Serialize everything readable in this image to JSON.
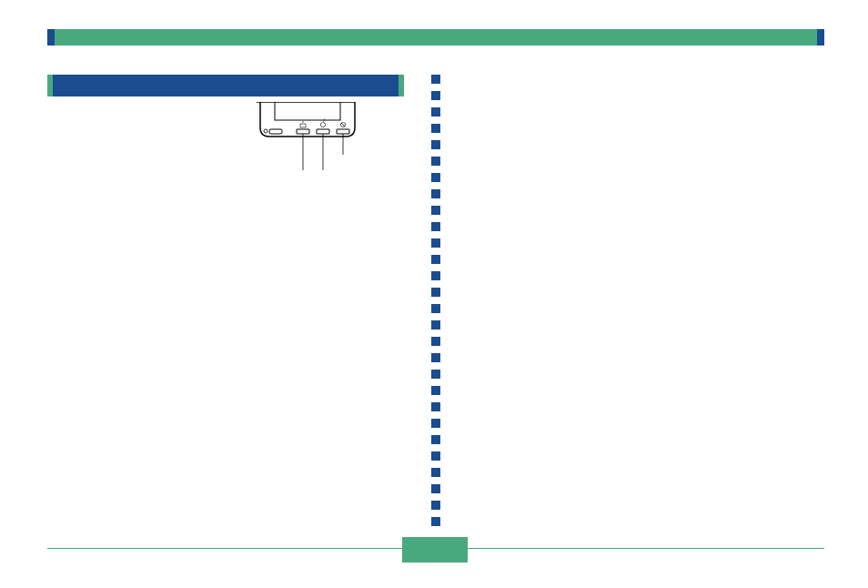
{
  "header": {
    "title": ""
  },
  "section": {
    "title": ""
  },
  "figure": {
    "label": ""
  },
  "page": {
    "number": ""
  }
}
